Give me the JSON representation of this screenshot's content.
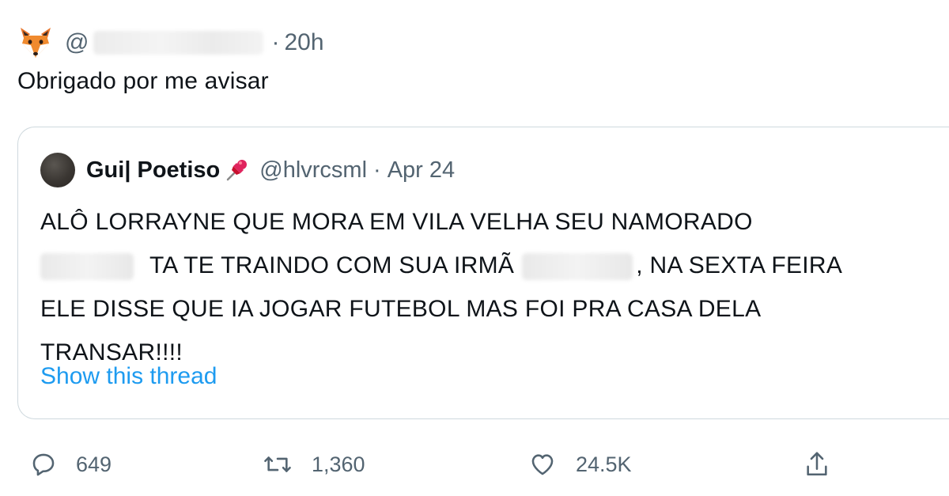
{
  "tweet": {
    "at_symbol": "@",
    "separator": "·",
    "time": "20h",
    "text": "Obrigado por me avisar",
    "author_avatar_icon": "fox-emoji-icon"
  },
  "quote": {
    "name": "Gui| Poetiso",
    "name_icon": "pushpin-icon",
    "handle": "@hlvrcsml",
    "separator": "·",
    "date": "Apr 24",
    "lines": [
      "ALÔ LORRAYNE QUE MORA EM VILA VELHA SEU NAMORADO",
      "TA TE TRAINDO COM SUA IRMÃ",
      ", NA SEXTA FEIRA",
      "ELE DISSE QUE IA JOGAR FUTEBOL MAS FOI PRA CASA DELA",
      "TRANSAR!!!!"
    ],
    "show_thread": "Show this thread"
  },
  "actions": {
    "reply": {
      "icon": "reply-icon",
      "count": "649"
    },
    "retweet": {
      "icon": "retweet-icon",
      "count": "1,360"
    },
    "like": {
      "icon": "heart-icon",
      "count": "24.5K"
    },
    "share": {
      "icon": "share-icon"
    }
  },
  "colors": {
    "text": "#0f1419",
    "secondary": "#536471",
    "link": "#1d9bf0",
    "border": "#cfd9de",
    "pin": "#e0245e"
  }
}
